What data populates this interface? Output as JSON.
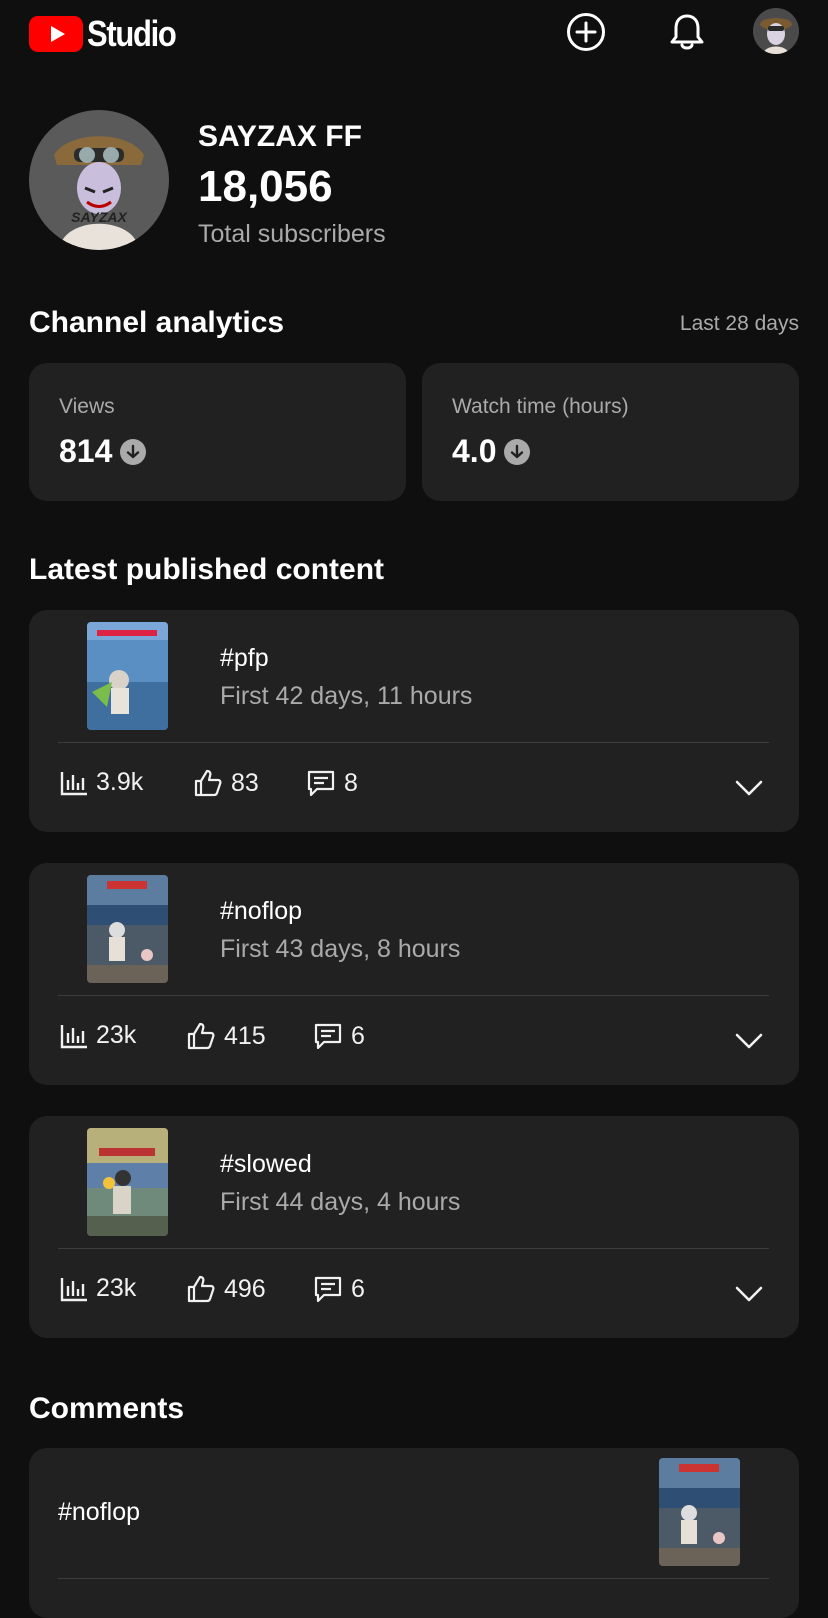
{
  "header": {
    "logo_text": "Studio",
    "create_icon": "plus-circle-icon",
    "notifications_icon": "bell-icon"
  },
  "profile": {
    "channel_name": "SAYZAX FF",
    "subscriber_count": "18,056",
    "subscriber_label": "Total subscribers"
  },
  "analytics": {
    "title": "Channel analytics",
    "period": "Last 28 days",
    "cards": [
      {
        "label": "Views",
        "value": "814",
        "trend_icon": "arrow-down-circle-icon"
      },
      {
        "label": "Watch time (hours)",
        "value": "4.0",
        "trend_icon": "arrow-down-circle-icon"
      }
    ]
  },
  "latest": {
    "title": "Latest published content",
    "items": [
      {
        "title": "#pfp",
        "subtitle": "First 42 days, 11 hours",
        "views": "3.9k",
        "likes": "83",
        "comments": "8"
      },
      {
        "title": "#noflop",
        "subtitle": "First 43 days, 8 hours",
        "views": "23k",
        "likes": "415",
        "comments": "6"
      },
      {
        "title": "#slowed",
        "subtitle": "First 44 days, 4 hours",
        "views": "23k",
        "likes": "496",
        "comments": "6"
      }
    ]
  },
  "comments": {
    "title": "Comments",
    "first_video_title": "#noflop"
  },
  "colors": {
    "background": "#0f0f0f",
    "card": "#212121",
    "brand_red": "#ff0000",
    "secondary_text": "#aaaaaa"
  }
}
